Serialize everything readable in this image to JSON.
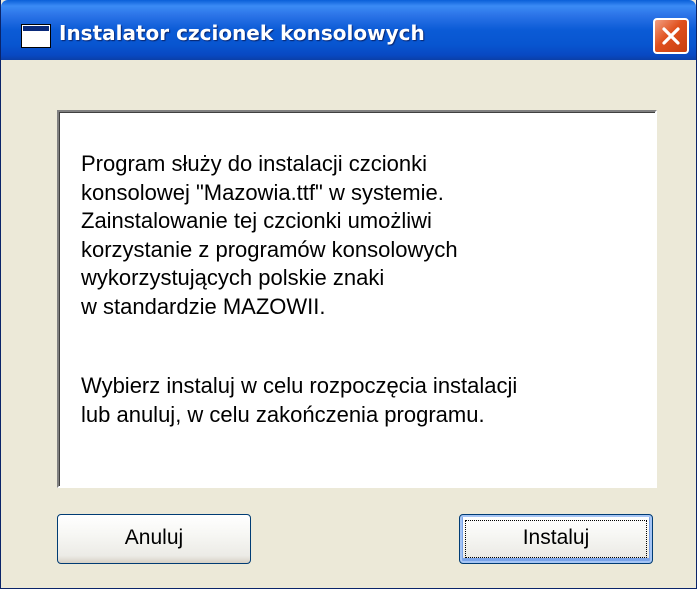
{
  "window": {
    "title": "Instalator czcionek konsolowych"
  },
  "content": {
    "paragraph1": "Program służy do instalacji czcionki\nkonsolowej \"Mazowia.ttf\" w systemie.\nZainstalowanie tej czcionki umożliwi\nkorzystanie z programów konsolowych\nwykorzystujących polskie znaki\nw standardzie MAZOWII.",
    "paragraph2": "Wybierz instaluj w celu rozpoczęcia instalacji\nlub anuluj, w celu zakończenia programu."
  },
  "buttons": {
    "cancel_label": "Anuluj",
    "install_label": "Instaluj"
  },
  "icons": {
    "window": "application-window-icon",
    "close": "close-icon"
  },
  "colors": {
    "titlebar": "#0855d0",
    "close_button": "#e0501d",
    "dialog_background": "#ece9d8",
    "text_panel": "#ffffff"
  }
}
